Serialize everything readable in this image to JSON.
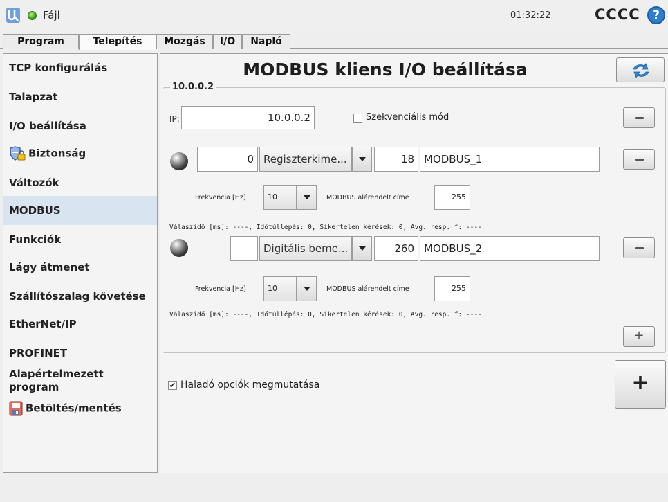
{
  "header": {
    "file_menu": "Fájl",
    "clock": "01:32:22",
    "robot_name": "CCCC",
    "help": "?"
  },
  "tabs": [
    {
      "label": "Program"
    },
    {
      "label": "Telepítés"
    },
    {
      "label": "Mozgás"
    },
    {
      "label": "I/O"
    },
    {
      "label": "Napló"
    }
  ],
  "sidebar": {
    "items": [
      {
        "label": "TCP konfigurálás"
      },
      {
        "label": "Talapzat"
      },
      {
        "label": "I/O beállítása"
      },
      {
        "label": "Biztonság",
        "icon": "shield-lock-icon"
      },
      {
        "label": "Változók"
      },
      {
        "label": "MODBUS",
        "active": true
      },
      {
        "label": "Funkciók"
      },
      {
        "label": "Lágy átmenet"
      },
      {
        "label": "Szállítószalag követése"
      },
      {
        "label": "EtherNet/IP"
      },
      {
        "label": "PROFINET"
      },
      {
        "label": "Alapértelmezett program"
      },
      {
        "label": "Betöltés/mentés",
        "icon": "save-icon"
      }
    ]
  },
  "main": {
    "title": "MODBUS kliens I/O beállítása",
    "server": {
      "legend": "10.0.0.2",
      "ip_label": "IP:",
      "ip_value": "10.0.0.2",
      "sequential_label": "Szekvenciális mód",
      "sequential_checked": false,
      "signals": [
        {
          "value": "0",
          "type": "Regiszterkime...",
          "address": "18",
          "name": "MODBUS_1",
          "freq_label": "Frekvencia [Hz]",
          "freq_value": "10",
          "slave_label": "MODBUS alárendelt címe",
          "slave_value": "255",
          "status": "Válaszidő [ms]: ----, Időtúllépés: 0, Sikertelen kérések: 0, Avg. resp. f: ----"
        },
        {
          "value": "",
          "type": "Digitális beme...",
          "address": "260",
          "name": "MODBUS_2",
          "freq_label": "Frekvencia [Hz]",
          "freq_value": "10",
          "slave_label": "MODBUS alárendelt címe",
          "slave_value": "255",
          "status": "Válaszidő [ms]: ----, Időtúllépés: 0, Sikertelen kérések: 0, Avg. resp. f: ----"
        }
      ],
      "add_signal_symbol": "+"
    },
    "advanced_label": "Haladó opciók megmutatása",
    "advanced_checked": true,
    "add_server_symbol": "+"
  }
}
